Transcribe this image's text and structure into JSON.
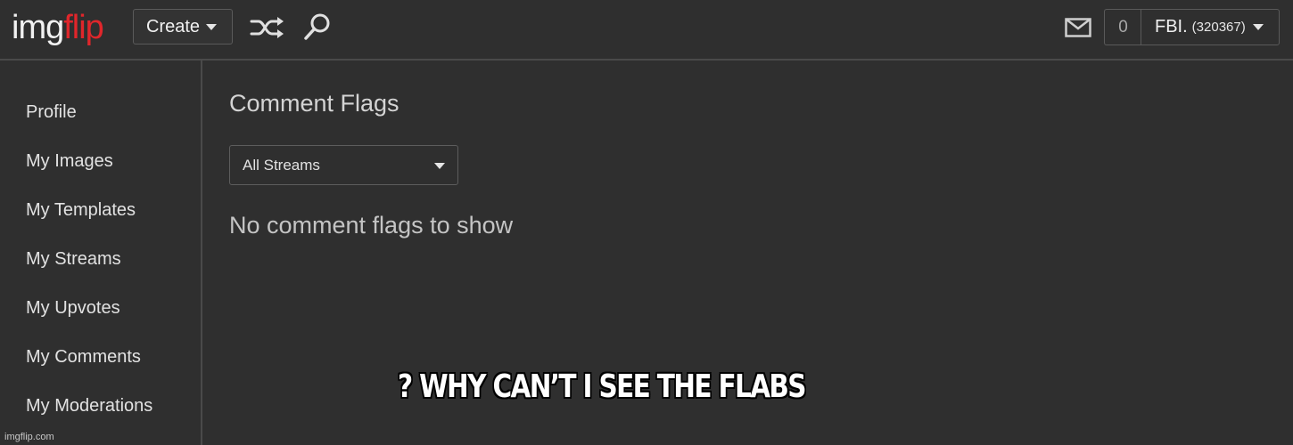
{
  "header": {
    "logo_part1": "img",
    "logo_part2": "flip",
    "create_label": "Create",
    "shuffle_icon": "shuffle-icon",
    "search_icon": "search-icon",
    "mail_icon": "mail-icon",
    "notification_count": "0",
    "username": "FBI.",
    "user_points": "(320367)"
  },
  "sidebar": {
    "items": [
      {
        "label": "Profile"
      },
      {
        "label": "My Images"
      },
      {
        "label": "My Templates"
      },
      {
        "label": "My Streams"
      },
      {
        "label": "My Upvotes"
      },
      {
        "label": "My Comments"
      },
      {
        "label": "My Moderations"
      }
    ]
  },
  "main": {
    "title": "Comment Flags",
    "stream_filter": "All Streams",
    "empty_message": "No comment flags to show"
  },
  "caption": "? WHY CAN’T I SEE THE FLABS",
  "watermark": "imgflip.com",
  "colors": {
    "background": "#2f2f2f",
    "logo_accent": "#e0262b",
    "text": "#e6e6e6",
    "border": "#5a5a5a"
  }
}
